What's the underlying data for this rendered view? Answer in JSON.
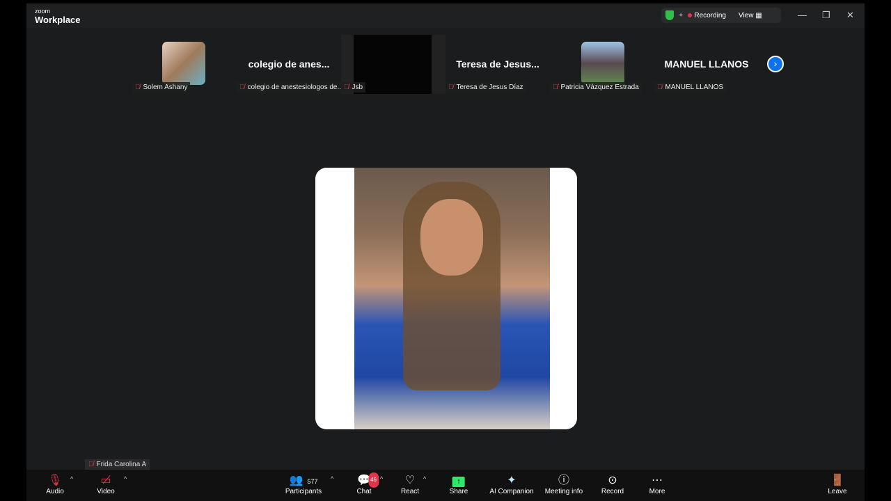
{
  "window": {
    "brand_small": "zoom",
    "brand": "Workplace",
    "recording": "Recording",
    "view": "View",
    "colors": {
      "recording": "#e0344a",
      "secure": "#2fbf4a",
      "share": "#2ee86a"
    }
  },
  "strip": [
    {
      "name": "Solem Ashany"
    },
    {
      "big": "colegio de anes...",
      "name": "colegio de anestesiologos de..."
    },
    {
      "name": "Jsb"
    },
    {
      "big": "Teresa de Jesus...",
      "name": "Teresa de Jesus Díaz"
    },
    {
      "name": "Patricia Vázquez Estrada"
    },
    {
      "big": "MANUEL LLANOS",
      "name": "MANUEL LLANOS"
    }
  ],
  "main": {
    "name": "Frida Carolina A"
  },
  "toolbar": {
    "audio": "Audio",
    "video": "Video",
    "participants": "Participants",
    "participants_count": "577",
    "chat": "Chat",
    "chat_badge": "46",
    "react": "React",
    "share": "Share",
    "ai": "AI Companion",
    "info": "Meeting info",
    "record": "Record",
    "more": "More",
    "leave": "Leave"
  }
}
